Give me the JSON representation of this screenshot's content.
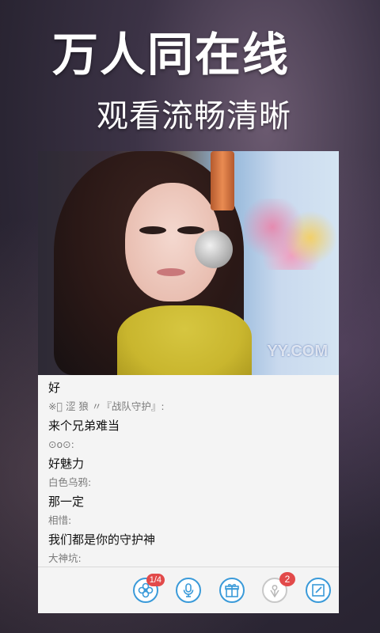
{
  "promo": {
    "headline": "万人同在线",
    "subline": "观看流畅清晰"
  },
  "video": {
    "watermark": "YY.COM"
  },
  "chat": {
    "messages": [
      {
        "type": "msg",
        "text": "好"
      },
      {
        "type": "user",
        "text": "※ﾞ 涩 狼 〃『战队守护』:"
      },
      {
        "type": "msg",
        "text": "来个兄弟难当"
      },
      {
        "type": "user",
        "text": "⊙o⊙:"
      },
      {
        "type": "msg",
        "text": "好魅力"
      },
      {
        "type": "user",
        "text": "白色乌鸦:"
      },
      {
        "type": "msg",
        "text": "那一定"
      },
      {
        "type": "user",
        "text": "相惜:"
      },
      {
        "type": "msg",
        "text": "我们都是你的守护神"
      },
      {
        "type": "user",
        "text": "大神坑:"
      }
    ]
  },
  "toolbar": {
    "flower_badge": "1/4",
    "gift_badge": "2",
    "accent_color": "#3a9ad9",
    "badge_color": "#e24a4a",
    "icons": [
      "flower-icon",
      "microphone-icon",
      "gift-icon",
      "flower-gift-icon",
      "edit-icon"
    ]
  }
}
